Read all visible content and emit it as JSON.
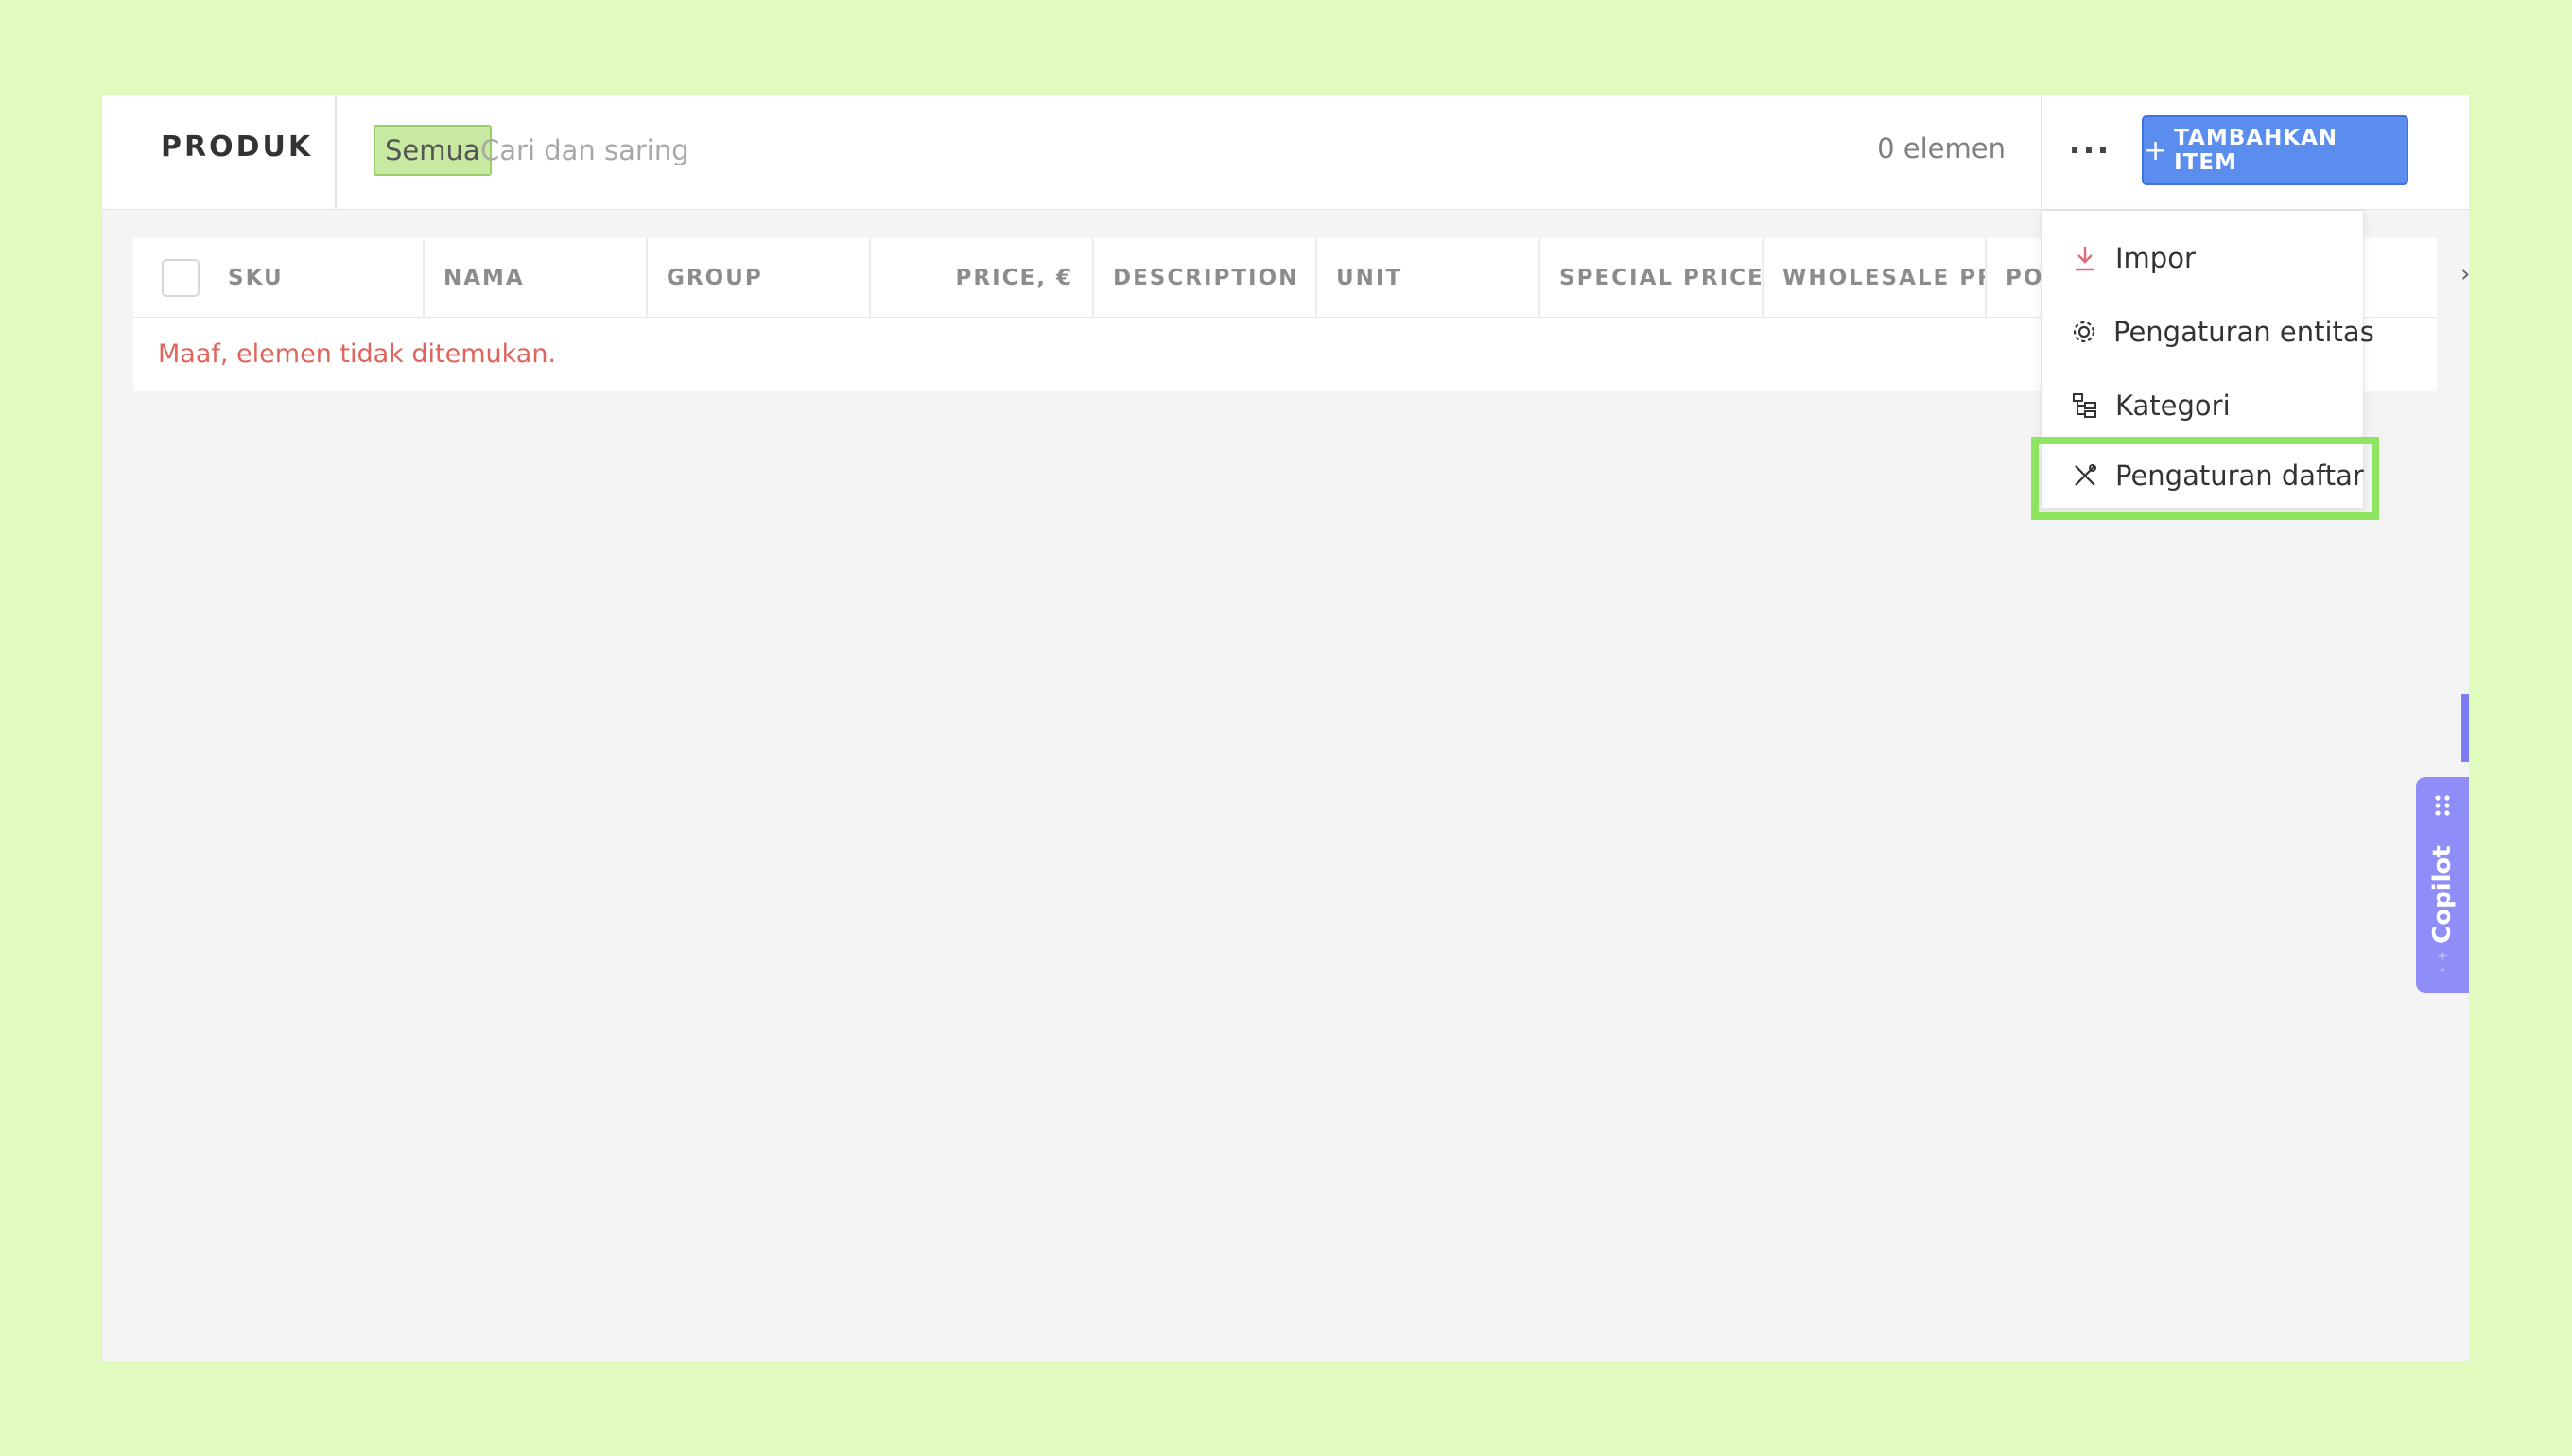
{
  "header": {
    "title": "PRODUK",
    "filter_chip": "Semua",
    "search_placeholder": "Cari dan saring",
    "count": "0 elemen",
    "add_button": "TAMBAHKAN ITEM",
    "add_button_plus": "+"
  },
  "table": {
    "columns": [
      "SKU",
      "NAMA",
      "GROUP",
      "PRICE, €",
      "DESCRIPTION",
      "UNIT",
      "SPECIAL PRICE",
      "WHOLESALE PR",
      "PO"
    ],
    "empty_message": "Maaf, elemen tidak ditemukan."
  },
  "menu": {
    "items": [
      {
        "label": "Impor",
        "icon": "download-icon"
      },
      {
        "label": "Pengaturan entitas",
        "icon": "gear-icon"
      },
      {
        "label": "Kategori",
        "icon": "hierarchy-icon"
      },
      {
        "label": "Pengaturan daftar",
        "icon": "tools-icon"
      }
    ]
  },
  "copilot": {
    "label": "Copilot"
  },
  "colors": {
    "background": "#e0fbbd",
    "primary_button": "#5b8def",
    "filter_chip": "#c7e9a2",
    "empty_text": "#e0645a",
    "highlight": "#8ee562",
    "copilot": "#8f8df7"
  }
}
